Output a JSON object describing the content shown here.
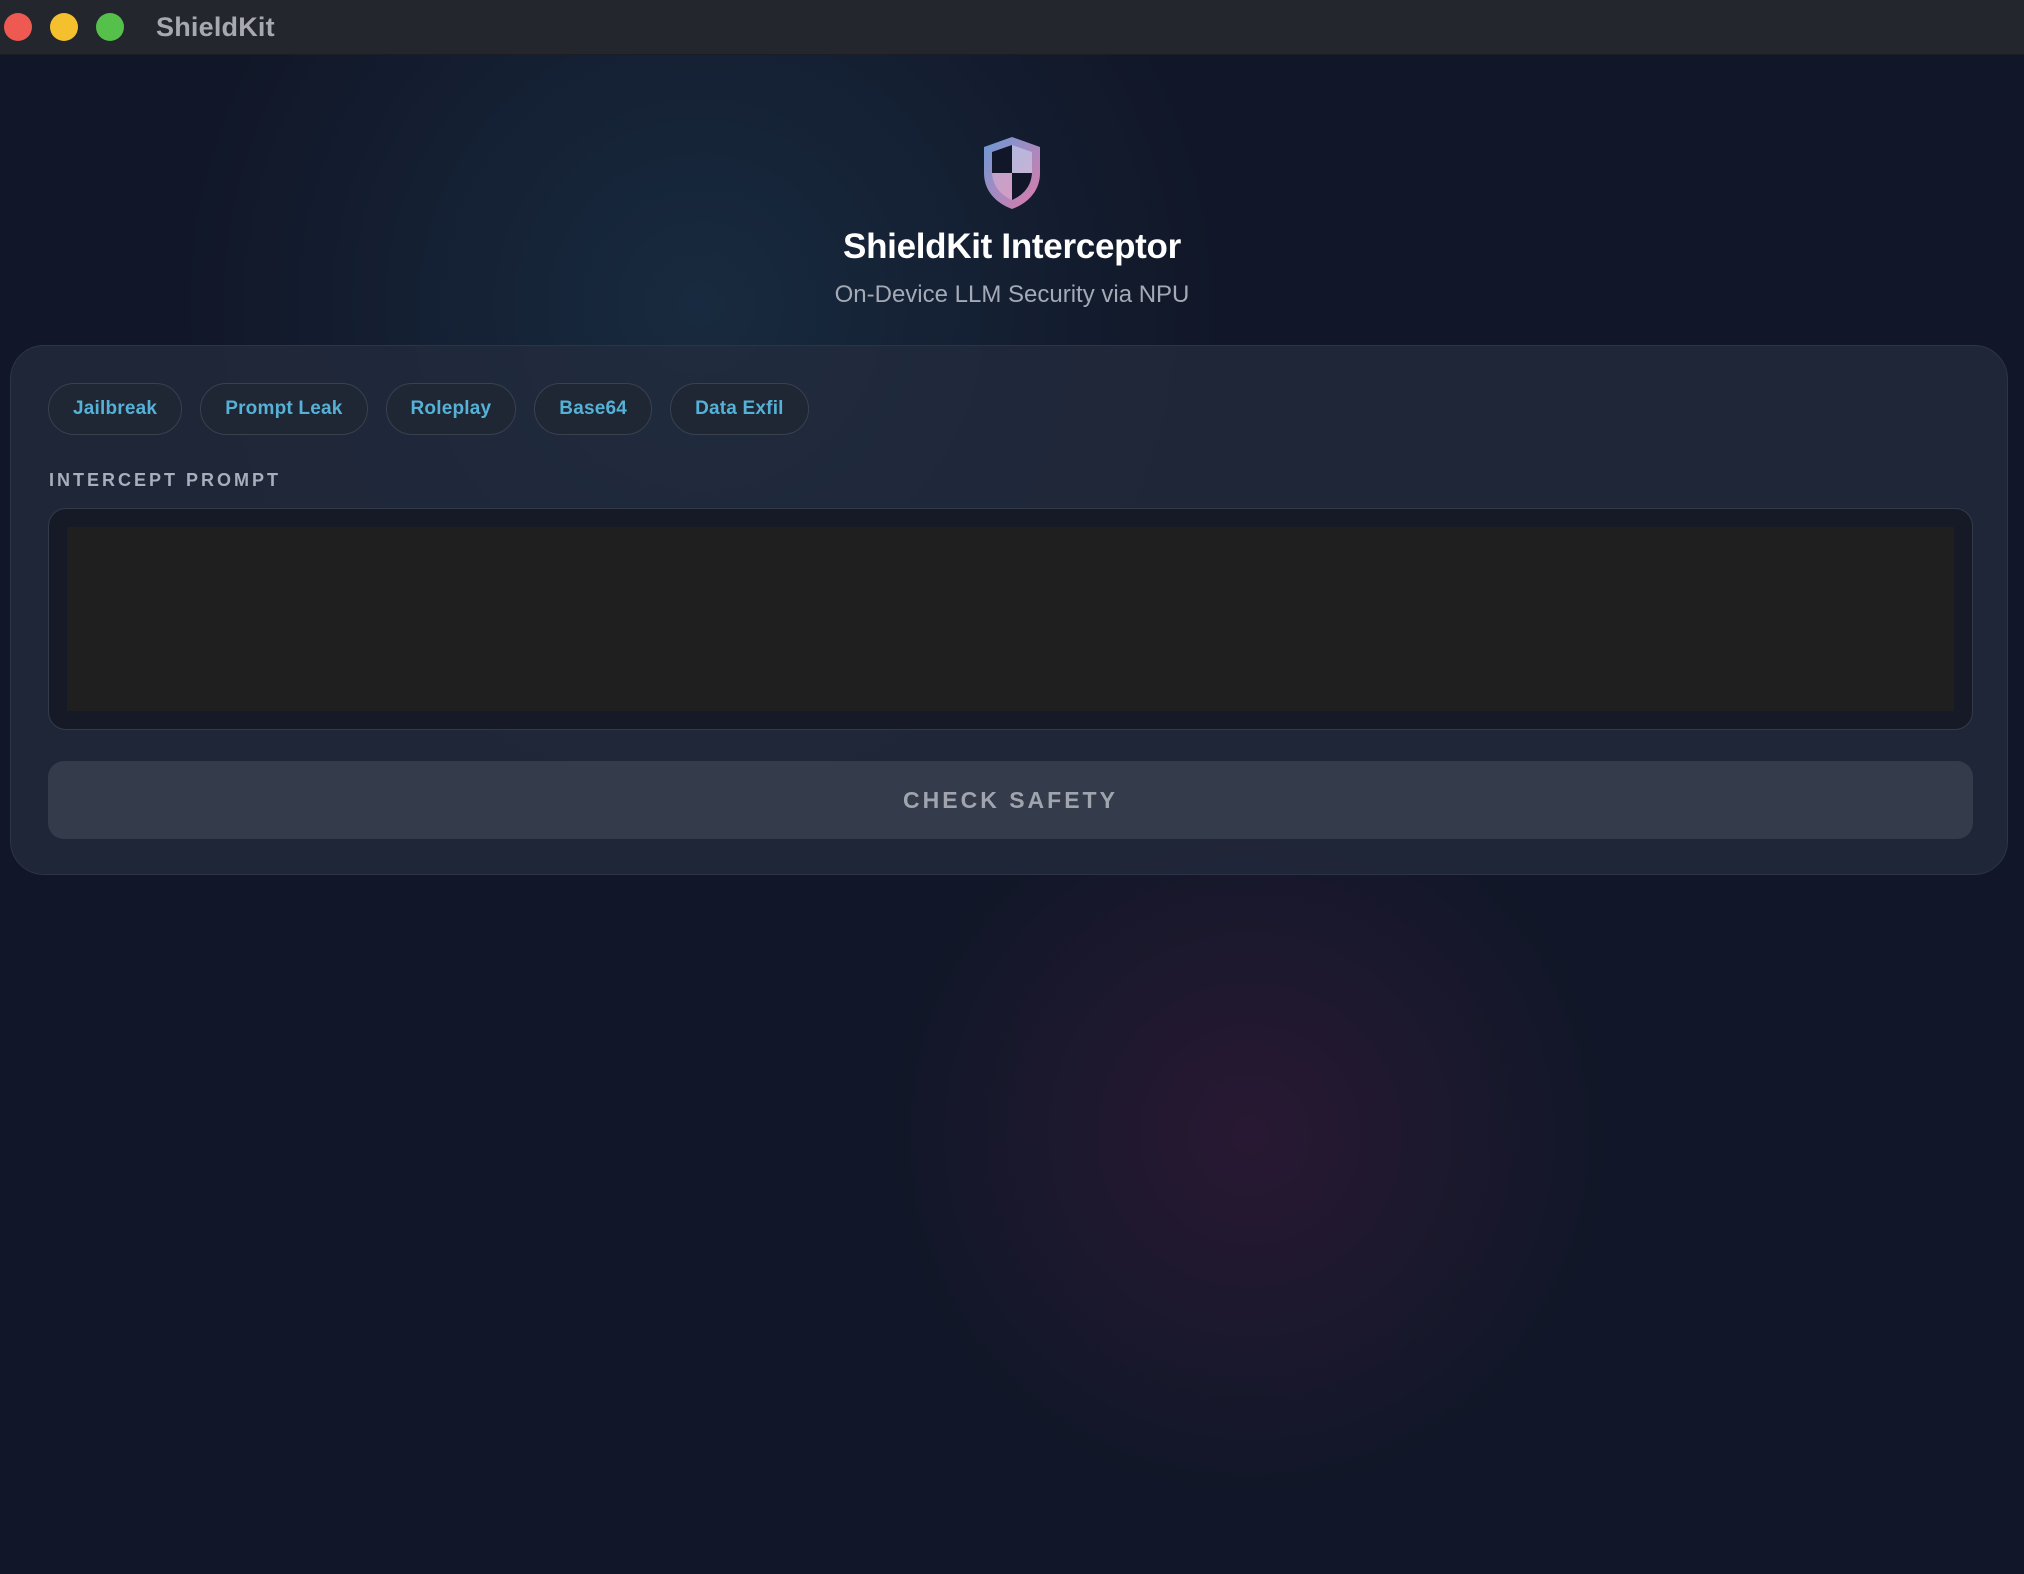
{
  "window": {
    "app_name": "ShieldKit"
  },
  "header": {
    "logo_icon": "shield-icon",
    "title": "ShieldKit Interceptor",
    "subtitle": "On-Device LLM Security via NPU"
  },
  "chips": [
    {
      "label": "Jailbreak"
    },
    {
      "label": "Prompt Leak"
    },
    {
      "label": "Roleplay"
    },
    {
      "label": "Base64"
    },
    {
      "label": "Data Exfil"
    }
  ],
  "prompt": {
    "label": "INTERCEPT PROMPT",
    "value": "",
    "placeholder": ""
  },
  "actions": {
    "check_label": "CHECK SAFETY"
  },
  "colors": {
    "background": "#111728",
    "chip_text": "#55b1d6",
    "shield_gradient_start": "#6a9ad6",
    "shield_gradient_end": "#e07aa9"
  }
}
